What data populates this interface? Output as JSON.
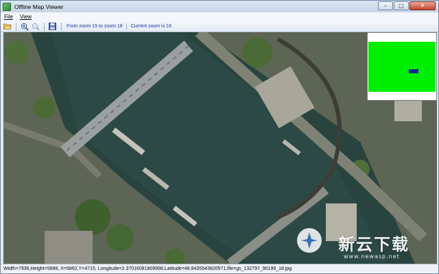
{
  "window": {
    "title": "Offline Map Viewer"
  },
  "menu": {
    "file": "File",
    "view": "View"
  },
  "toolbar": {
    "zoom_range": "From zoom 15 to zoom 18",
    "current_zoom": "Current zoom is 18"
  },
  "status": "Width=7936,Height=5888, X=5862,Y=4715, Longitude=2.37016081809998,Latitude=48.8435543820571,file=gs_132797_90199_18.jpg",
  "watermark": {
    "text": "新云下载",
    "url": "www.newasp.net"
  },
  "icons": {
    "app": "map-app-icon",
    "open": "folder-open-icon",
    "zoom_in": "zoom-in-icon",
    "zoom_out": "zoom-out-icon",
    "save": "save-icon",
    "minimize": "minimize-icon",
    "maximize": "maximize-icon",
    "close": "close-icon"
  }
}
